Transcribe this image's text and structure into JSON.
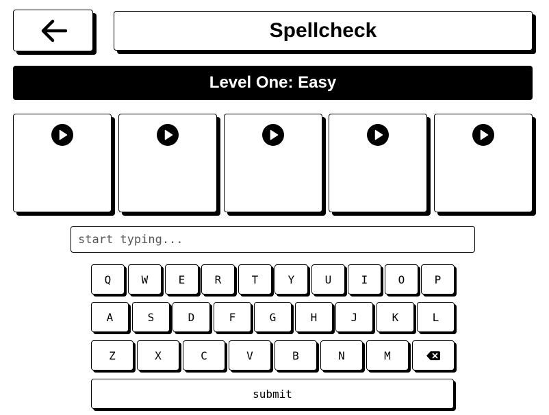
{
  "header": {
    "back_icon": "arrow-left-icon",
    "title": "Spellcheck"
  },
  "level": {
    "label": "Level One: Easy"
  },
  "audio_cards": [
    {
      "icon": "play-icon"
    },
    {
      "icon": "play-icon"
    },
    {
      "icon": "play-icon"
    },
    {
      "icon": "play-icon"
    },
    {
      "icon": "play-icon"
    }
  ],
  "input": {
    "value": "",
    "placeholder": "start typing..."
  },
  "keyboard": {
    "row1": [
      "Q",
      "W",
      "E",
      "R",
      "T",
      "Y",
      "U",
      "I",
      "O",
      "P"
    ],
    "row2": [
      "A",
      "S",
      "D",
      "F",
      "G",
      "H",
      "J",
      "K",
      "L"
    ],
    "row3": [
      "Z",
      "X",
      "C",
      "V",
      "B",
      "N",
      "M"
    ],
    "backspace_icon": "backspace-icon",
    "submit_label": "submit"
  },
  "colors": {
    "primary": "#000000",
    "background": "#ffffff"
  }
}
